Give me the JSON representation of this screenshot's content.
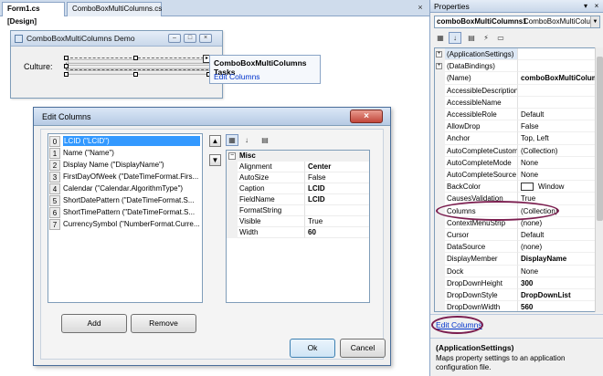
{
  "document_tabs": [
    {
      "label": "Form1.cs [Design]",
      "active": true
    },
    {
      "label": "ComboBoxMultiColumns.cs",
      "active": false
    }
  ],
  "form": {
    "title": "ComboBoxMultiColumns Demo",
    "culture_label": "Culture:",
    "smart_tag_glyph": "▸"
  },
  "tasks_panel": {
    "title": "ComboBoxMultiColumns Tasks",
    "link": "Edit Columns"
  },
  "dialog": {
    "title": "Edit Columns",
    "columns": [
      {
        "index": "0",
        "text": "LCID (\"LCID\")",
        "selected": true
      },
      {
        "index": "1",
        "text": "Name (\"Name\")"
      },
      {
        "index": "2",
        "text": "Display Name (\"DisplayName\")"
      },
      {
        "index": "3",
        "text": "FirstDayOfWeek (\"DateTimeFormat.Firs..."
      },
      {
        "index": "4",
        "text": "Calendar (\"Calendar.AlgorithmType\")"
      },
      {
        "index": "5",
        "text": "ShortDatePattern (\"DateTimeFormat.S..."
      },
      {
        "index": "6",
        "text": "ShortTimePattern (\"DateTimeFormat.S..."
      },
      {
        "index": "7",
        "text": "CurrencySymbol (\"NumberFormat.Curre..."
      }
    ],
    "move_up_glyph": "▲",
    "move_down_glyph": "▼",
    "add_label": "Add",
    "remove_label": "Remove",
    "ok_label": "Ok",
    "cancel_label": "Cancel",
    "property_category": "Misc",
    "properties": [
      {
        "name": "Alignment",
        "value": "Center",
        "bold": true
      },
      {
        "name": "AutoSize",
        "value": "False",
        "bold": false
      },
      {
        "name": "Caption",
        "value": "LCID",
        "bold": true
      },
      {
        "name": "FieldName",
        "value": "LCID",
        "bold": true
      },
      {
        "name": "FormatString",
        "value": "",
        "bold": false
      },
      {
        "name": "Visible",
        "value": "True",
        "bold": false
      },
      {
        "name": "Width",
        "value": "60",
        "bold": true
      }
    ]
  },
  "properties_panel": {
    "title": "Properties",
    "pin_glyph": "▾",
    "close_glyph": "×",
    "object_name": "comboBoxMultiColumns1",
    "object_type": "ComboBoxMultiColun",
    "rows": [
      {
        "name": "(ApplicationSettings)",
        "value": "",
        "expandable": true,
        "selected": true
      },
      {
        "name": "(DataBindings)",
        "value": "",
        "expandable": true
      },
      {
        "name": "(Name)",
        "value": "comboBoxMultiColumn",
        "bold": true
      },
      {
        "name": "AccessibleDescription",
        "value": ""
      },
      {
        "name": "AccessibleName",
        "value": ""
      },
      {
        "name": "AccessibleRole",
        "value": "Default"
      },
      {
        "name": "AllowDrop",
        "value": "False"
      },
      {
        "name": "Anchor",
        "value": "Top, Left"
      },
      {
        "name": "AutoCompleteCustom",
        "value": "(Collection)"
      },
      {
        "name": "AutoCompleteMode",
        "value": "None"
      },
      {
        "name": "AutoCompleteSource",
        "value": "None"
      },
      {
        "name": "BackColor",
        "value": "Window",
        "swatch": true
      },
      {
        "name": "CausesValidation",
        "value": "True"
      },
      {
        "name": "Columns",
        "value": "(Collection)"
      },
      {
        "name": "ContextMenuStrip",
        "value": "(none)"
      },
      {
        "name": "Cursor",
        "value": "Default"
      },
      {
        "name": "DataSource",
        "value": "(none)"
      },
      {
        "name": "DisplayMember",
        "value": "DisplayName",
        "bold": true
      },
      {
        "name": "Dock",
        "value": "None"
      },
      {
        "name": "DropDownHeight",
        "value": "300",
        "bold": true
      },
      {
        "name": "DropDownStyle",
        "value": "DropDownList",
        "bold": true
      },
      {
        "name": "DropDownWidth",
        "value": "560",
        "bold": true
      }
    ],
    "command_link": "Edit Columns",
    "description_title": "(ApplicationSettings)",
    "description_text": "Maps property settings to an application configuration file."
  },
  "colors": {
    "annotation": "#7b1e4f",
    "selection": "#3399ff",
    "link": "#0033cc"
  }
}
